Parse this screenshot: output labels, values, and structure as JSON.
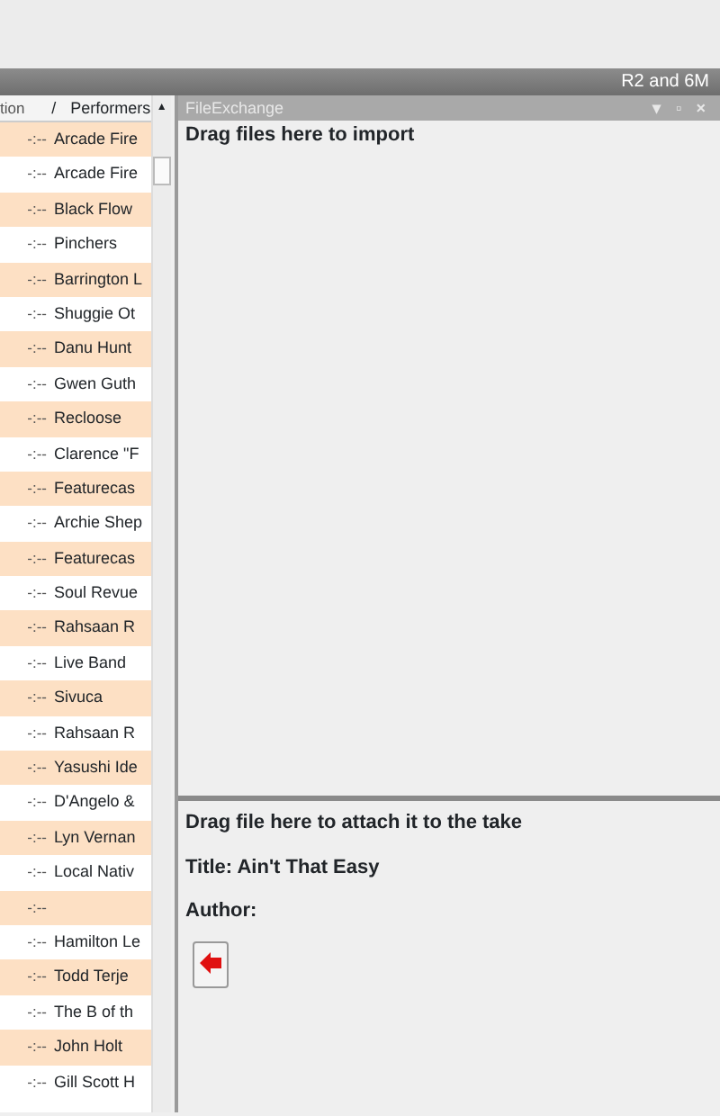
{
  "top_bar": {
    "title": "R2 and 6M"
  },
  "track_list": {
    "columns": [
      "tion",
      "/",
      "Performers"
    ],
    "scroll_up": "▲",
    "rows": [
      {
        "duration": "-:--",
        "performer": "Arcade Fire"
      },
      {
        "duration": "-:--",
        "performer": "Arcade Fire"
      },
      {
        "duration": "-:--",
        "performer": "Black Flow"
      },
      {
        "duration": "-:--",
        "performer": "Pinchers"
      },
      {
        "duration": "-:--",
        "performer": "Barrington L"
      },
      {
        "duration": "-:--",
        "performer": "Shuggie Ot"
      },
      {
        "duration": "-:--",
        "performer": "Danu Hunt"
      },
      {
        "duration": "-:--",
        "performer": "Gwen Guth"
      },
      {
        "duration": "-:--",
        "performer": "Recloose"
      },
      {
        "duration": "-:--",
        "performer": "Clarence \"F"
      },
      {
        "duration": "-:--",
        "performer": "Featurecas"
      },
      {
        "duration": "-:--",
        "performer": "Archie Shep"
      },
      {
        "duration": "-:--",
        "performer": "Featurecas"
      },
      {
        "duration": "-:--",
        "performer": "Soul Revue"
      },
      {
        "duration": "-:--",
        "performer": "Rahsaan R"
      },
      {
        "duration": "-:--",
        "performer": "Live Band"
      },
      {
        "duration": "-:--",
        "performer": "Sivuca"
      },
      {
        "duration": "-:--",
        "performer": "Rahsaan R"
      },
      {
        "duration": "-:--",
        "performer": "Yasushi Ide"
      },
      {
        "duration": "-:--",
        "performer": "D'Angelo &"
      },
      {
        "duration": "-:--",
        "performer": "Lyn Vernan"
      },
      {
        "duration": "-:--",
        "performer": "Local Nativ"
      },
      {
        "duration": "-:--"
      },
      {
        "duration": "-:--",
        "performer": "Hamilton Le"
      },
      {
        "duration": "-:--",
        "performer": "Todd Terje"
      },
      {
        "duration": "-:--",
        "performer": "The B of th"
      },
      {
        "duration": "-:--",
        "performer": "John Holt"
      },
      {
        "duration": "-:--",
        "performer": "Gill Scott H"
      }
    ]
  },
  "file_exchange": {
    "title": "FileExchange",
    "controls": [
      "▾",
      "▫",
      "×"
    ],
    "import_hint": "Drag files here to import",
    "attach_hint": "Drag file here to attach it to the take",
    "title_line": "Title: Ain't That Easy",
    "author_line": "Author:"
  }
}
